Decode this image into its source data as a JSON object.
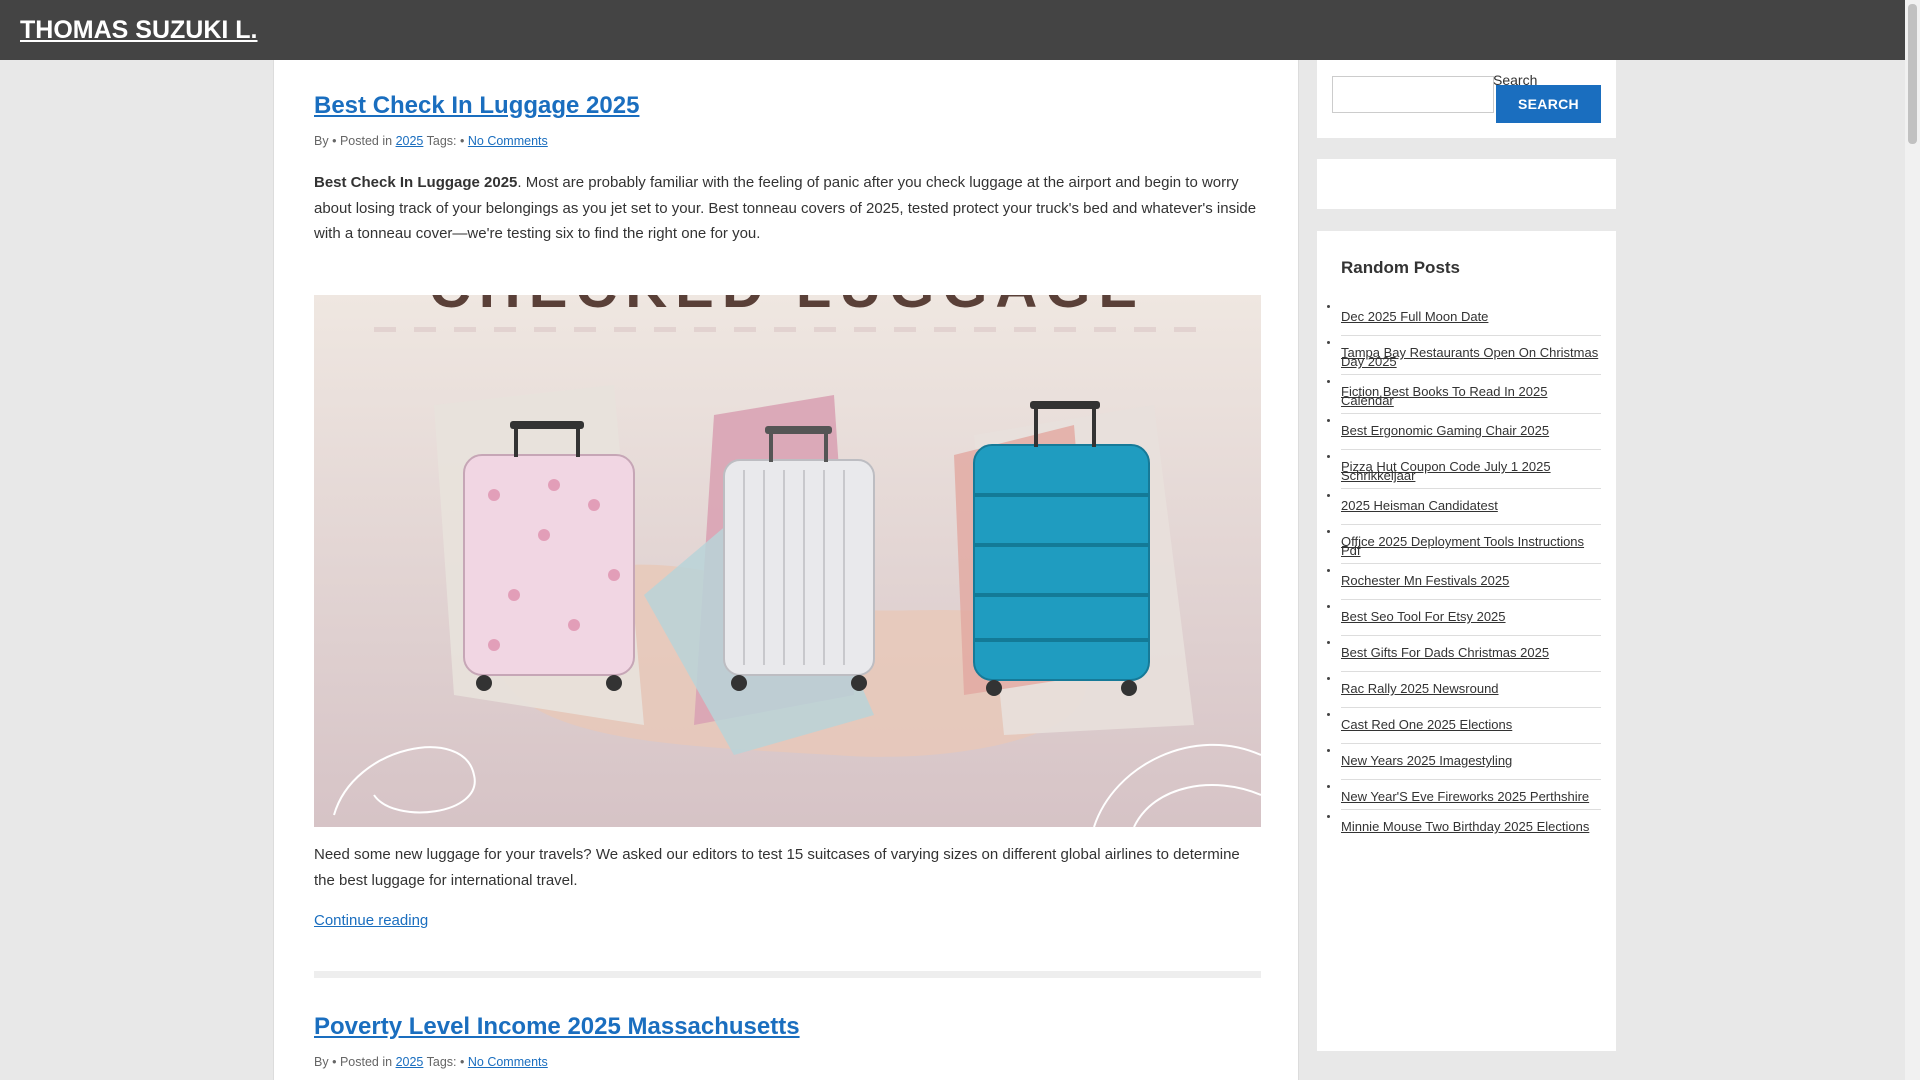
{
  "site": {
    "title": "THOMAS SUZUKI L."
  },
  "posts": [
    {
      "title": "Best Check In Luggage 2025",
      "meta": {
        "by": "By",
        "sep1": "•",
        "posted_in": "Posted in",
        "category": "2025",
        "tags": "Tags:",
        "sep2": "•",
        "comments": "No Comments"
      },
      "excerpt_bold": "Best Check In Luggage 2025",
      "excerpt_rest": ". Most are probably familiar with the feeling of panic after you check luggage at the airport and begin to worry about losing track of your belongings as you jet set to your. Best tonneau covers of 2025, tested protect your truck's bed and whatever's inside with a tonneau cover—we're testing six to find the right one for you.",
      "image_caption_text": "CHECKED LUGGAGE",
      "after": "Need some new luggage for your travels? We asked our editors to test 15 suitcases of varying sizes on different global airlines to determine the best luggage for international travel.",
      "continue": "Continue reading"
    },
    {
      "title": "Poverty Level Income 2025 Massachusetts",
      "meta": {
        "by": "By",
        "sep1": "•",
        "posted_in": "Posted in",
        "category": "2025",
        "tags": "Tags:",
        "sep2": "•",
        "comments": "No Comments"
      }
    }
  ],
  "sidebar": {
    "search": {
      "label": "Search",
      "button": "SEARCH",
      "value": ""
    },
    "random_posts": {
      "title": "Random Posts",
      "items": [
        "Dec 2025 Full Moon Date",
        "Tampa Bay Restaurants Open On Christmas Day 2025",
        "Fiction Best Books To Read In 2025 Calendar",
        "Best Ergonomic Gaming Chair 2025",
        "Pizza Hut Coupon Code July 1 2025 Schrikkeljaar",
        "2025 Heisman Candidatest",
        "Office 2025 Deployment Tools Instructions Pdf",
        "Rochester Mn Festivals 2025",
        "Best Seo Tool For Etsy 2025",
        "Best Gifts For Dads Christmas 2025",
        "Rac Rally 2025 Newsround",
        "Cast Red One 2025 Elections",
        "New Years 2025 Imagestyling",
        "New Year'S Eve Fireworks 2025 Perthshire",
        "Minnie Mouse Two Birthday 2025 Elections"
      ]
    }
  },
  "colors": {
    "accent": "#1a6ebf",
    "topbar": "#444444",
    "background": "#e8e8e8"
  }
}
